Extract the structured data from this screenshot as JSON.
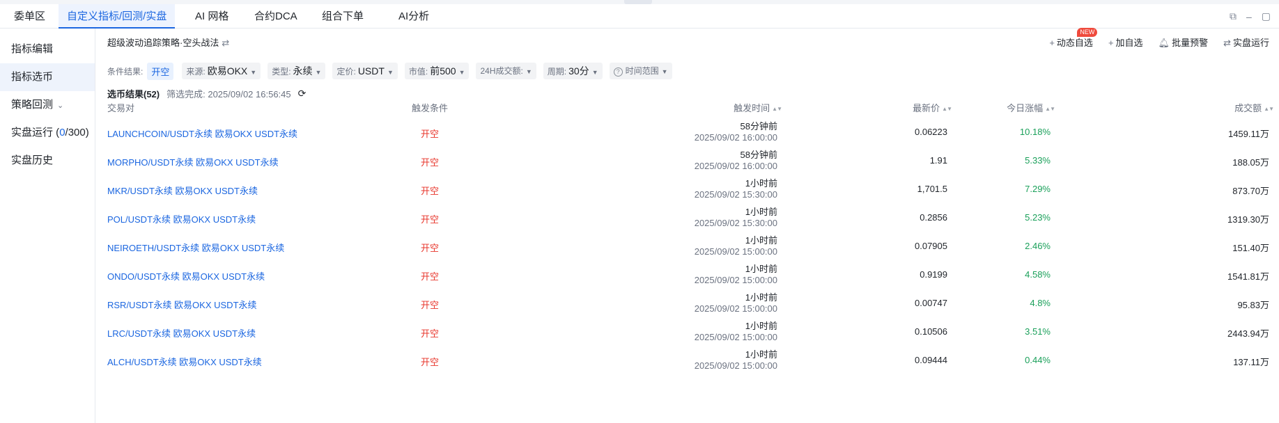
{
  "tabs": [
    "委单区",
    "自定义指标/回测/实盘",
    "AI 网格",
    "合约DCA",
    "组合下单",
    "AI分析"
  ],
  "sidebar": [
    {
      "label": "指标编辑"
    },
    {
      "label": "指标选币"
    },
    {
      "label": "策略回测"
    },
    {
      "label": "实盘运行",
      "count_open": " (",
      "count_current": "0",
      "count_rest": "/300)"
    },
    {
      "label": "实盘历史"
    }
  ],
  "strategy": {
    "title": "超级波动追踪策略·空头战法"
  },
  "actions": {
    "dynamic": "动态自选",
    "new_badge": "NEW",
    "add": "加自选",
    "alert": "批量预警",
    "live": "实盘运行"
  },
  "filters": {
    "cond_label": "条件结果:",
    "cond_value": "开空",
    "source_label": "来源:",
    "source_value": "欧易OKX",
    "type_label": "类型:",
    "type_value": "永续",
    "quote_label": "定价:",
    "quote_value": "USDT",
    "mcap_label": "市值:",
    "mcap_value": "前500",
    "vol24_label": "24H成交额:",
    "period_label": "周期:",
    "period_value": "30分",
    "range_label": "时间范围"
  },
  "results": {
    "title": "选币结果(52)",
    "status": "筛选完成: 2025/09/02 16:56:45"
  },
  "table": {
    "headers": {
      "pair": "交易对",
      "trigger": "触发条件",
      "time": "触发时间",
      "price": "最新价",
      "change": "今日涨幅",
      "volume": "成交额"
    },
    "rows": [
      {
        "pair": "LAUNCHCOIN/USDT永续 欧易OKX USDT永续",
        "trigger": "开空",
        "ago": "58分钟前",
        "ts": "2025/09/02 16:00:00",
        "price": "0.06223",
        "change": "10.18%",
        "volume": "1459.11万"
      },
      {
        "pair": "MORPHO/USDT永续 欧易OKX USDT永续",
        "trigger": "开空",
        "ago": "58分钟前",
        "ts": "2025/09/02 16:00:00",
        "price": "1.91",
        "change": "5.33%",
        "volume": "188.05万"
      },
      {
        "pair": "MKR/USDT永续 欧易OKX USDT永续",
        "trigger": "开空",
        "ago": "1小时前",
        "ts": "2025/09/02 15:30:00",
        "price": "1,701.5",
        "change": "7.29%",
        "volume": "873.70万"
      },
      {
        "pair": "POL/USDT永续 欧易OKX USDT永续",
        "trigger": "开空",
        "ago": "1小时前",
        "ts": "2025/09/02 15:30:00",
        "price": "0.2856",
        "change": "5.23%",
        "volume": "1319.30万"
      },
      {
        "pair": "NEIROETH/USDT永续 欧易OKX USDT永续",
        "trigger": "开空",
        "ago": "1小时前",
        "ts": "2025/09/02 15:00:00",
        "price": "0.07905",
        "change": "2.46%",
        "volume": "151.40万"
      },
      {
        "pair": "ONDO/USDT永续 欧易OKX USDT永续",
        "trigger": "开空",
        "ago": "1小时前",
        "ts": "2025/09/02 15:00:00",
        "price": "0.9199",
        "change": "4.58%",
        "volume": "1541.81万"
      },
      {
        "pair": "RSR/USDT永续 欧易OKX USDT永续",
        "trigger": "开空",
        "ago": "1小时前",
        "ts": "2025/09/02 15:00:00",
        "price": "0.00747",
        "change": "4.8%",
        "volume": "95.83万"
      },
      {
        "pair": "LRC/USDT永续 欧易OKX USDT永续",
        "trigger": "开空",
        "ago": "1小时前",
        "ts": "2025/09/02 15:00:00",
        "price": "0.10506",
        "change": "3.51%",
        "volume": "2443.94万"
      },
      {
        "pair": "ALCH/USDT永续 欧易OKX USDT永续",
        "trigger": "开空",
        "ago": "1小时前",
        "ts": "2025/09/02 15:00:00",
        "price": "0.09444",
        "change": "0.44%",
        "volume": "137.11万"
      }
    ]
  },
  "colors": {
    "accent": "#1b66e0",
    "short": "#e8352b",
    "up": "#1aa05a"
  },
  "icons": [
    "swap-icon",
    "plus-icon",
    "bell-icon",
    "exchange-icon",
    "refresh-icon",
    "help-icon",
    "chevron-down-icon",
    "sort-icon",
    "restore-window-icon",
    "minimize-icon",
    "maximize-icon"
  ]
}
